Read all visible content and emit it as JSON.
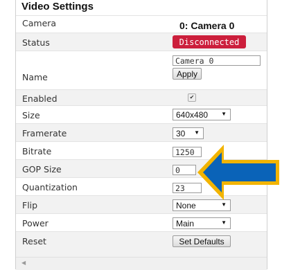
{
  "panel": {
    "title": "Video Settings"
  },
  "rows": {
    "camera": {
      "label": "Camera",
      "value": "0: Camera 0"
    },
    "status": {
      "label": "Status",
      "badge": "Disconnected",
      "badge_color": "#cc1f3c"
    },
    "name": {
      "label": "Name",
      "value": "Camera 0",
      "apply_label": "Apply"
    },
    "enabled": {
      "label": "Enabled",
      "checked": true,
      "check_glyph": "✔"
    },
    "size": {
      "label": "Size",
      "selected": "640x480"
    },
    "framerate": {
      "label": "Framerate",
      "selected": "30"
    },
    "bitrate": {
      "label": "Bitrate",
      "value": "1250"
    },
    "gop": {
      "label": "GOP Size",
      "value": "0"
    },
    "quantization": {
      "label": "Quantization",
      "value": "23"
    },
    "flip": {
      "label": "Flip",
      "selected": "None"
    },
    "power": {
      "label": "Power",
      "selected": "Main"
    },
    "reset": {
      "label": "Reset",
      "button_label": "Set Defaults"
    }
  },
  "annotation": {
    "icon": "blue-arrow-icon",
    "fill": "#0a63b8",
    "outline": "#f2b400"
  },
  "scrollbar": {
    "left_icon": "scroll-left-icon"
  }
}
